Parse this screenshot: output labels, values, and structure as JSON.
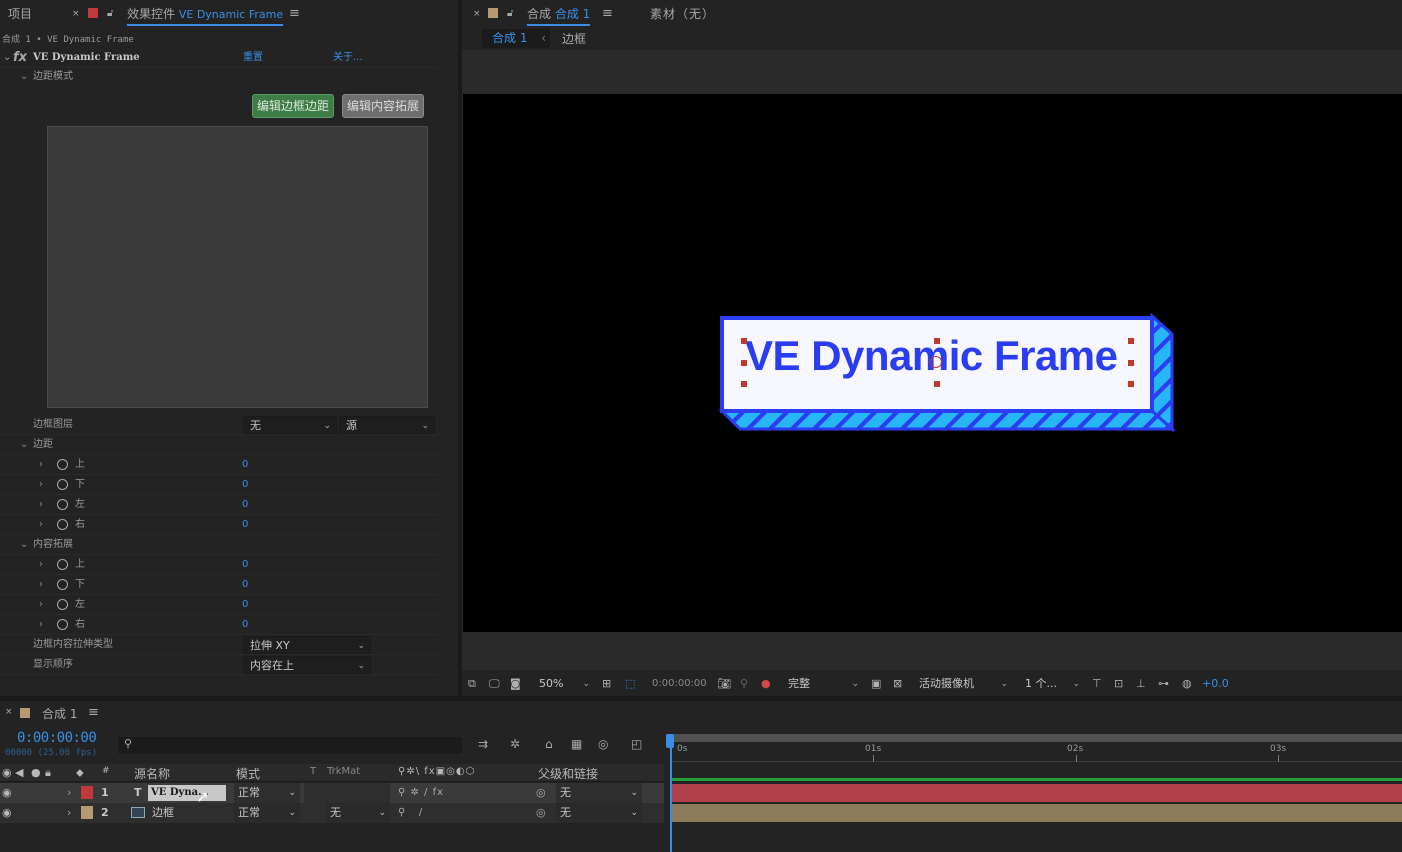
{
  "left_panel": {
    "tab_project": "项目",
    "tab_effects_prefix": "效果控件",
    "tab_effects_layer": "VE Dynamic Frame",
    "breadcrumb": "合成 1 • VE Dynamic Frame",
    "effect_fx": "fx",
    "effect_name": "VE Dynamic Frame",
    "reset": "重置",
    "about": "关于...",
    "margin_mode": "边距模式",
    "btn_edit_border": "编辑边框边距",
    "btn_edit_content": "编辑内容拓展",
    "frame_layer_label": "边框图层",
    "frame_layer_value": "无",
    "frame_source_value": "源",
    "margin_group": "边距",
    "content_group": "内容拓展",
    "stretch_label": "边框内容拉伸类型",
    "stretch_value": "拉伸 XY",
    "order_label": "显示顺序",
    "order_value": "内容在上",
    "margins": [
      {
        "label": "上",
        "value": "0"
      },
      {
        "label": "下",
        "value": "0"
      },
      {
        "label": "左",
        "value": "0"
      },
      {
        "label": "右",
        "value": "0"
      }
    ],
    "content": [
      {
        "label": "上",
        "value": "0"
      },
      {
        "label": "下",
        "value": "0"
      },
      {
        "label": "左",
        "value": "0"
      },
      {
        "label": "右",
        "value": "0"
      }
    ]
  },
  "viewer": {
    "tab_comp_prefix": "合成",
    "tab_comp_name": "合成 1",
    "tab_footage": "素材（无）",
    "crumb_comp": "合成 1",
    "crumb_layer": "边框",
    "frame_text": "VE Dynamic Frame",
    "zoom": "50%",
    "timecode": "0:00:00:00",
    "quality": "完整",
    "camera": "活动摄像机",
    "views": "1 个...",
    "exposure": "+0.0",
    "colors": {
      "frame_blue": "#2a3df0",
      "stripe_cyan": "#27b6f6",
      "frame_bg": "#f7f8ff"
    }
  },
  "timeline": {
    "tab": "合成 1",
    "timecode": "0:00:00:00",
    "frame_info": "00000 (25.00 fps)",
    "search_placeholder": "",
    "col_num": "#",
    "col_source": "源名称",
    "col_mode": "模式",
    "col_t": "T",
    "col_trkmat": "TrkMat",
    "col_parent": "父级和链接",
    "ruler": [
      "0s",
      "01s",
      "02s",
      "03s"
    ],
    "layers": [
      {
        "num": "1",
        "type": "T",
        "name": "VE Dyna...",
        "mode": "正常",
        "trkmat": "",
        "parent": "无",
        "color": "#c0393c",
        "bar": "#b1404a"
      },
      {
        "num": "2",
        "type": "",
        "name": "边框",
        "mode": "正常",
        "trkmat": "无",
        "parent": "无",
        "color": "#b59a73",
        "bar": "#8d7c5a"
      }
    ]
  }
}
